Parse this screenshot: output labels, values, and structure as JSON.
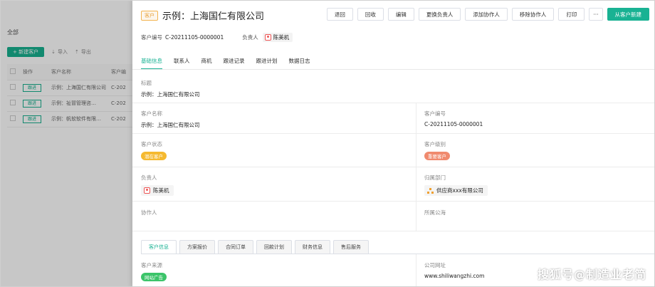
{
  "bg": {
    "crumb": "全部",
    "new_button": "+ 新建客户",
    "import": "导入",
    "export": "导出",
    "columns": [
      "操作",
      "客户名称",
      "客户编"
    ],
    "rows": [
      {
        "action": "跟进",
        "name": "示例：上海国仁有限公司",
        "code": "C-202"
      },
      {
        "action": "跟进",
        "name": "示例：祉冒管理咨…",
        "code": "C-202"
      },
      {
        "action": "跟进",
        "name": "示例：帆软软件有限…",
        "code": "C-202"
      }
    ]
  },
  "header": {
    "tag": "客户",
    "title": "示例：上海国仁有限公司",
    "actions": [
      "退回",
      "回收",
      "编辑",
      "更换负责人",
      "添加协作人",
      "移除协作人",
      "打印"
    ],
    "more": "···",
    "primary": "从客户新建"
  },
  "meta": {
    "code_label": "客户编号",
    "code_value": "C-20211105-0000001",
    "owner_label": "负责人",
    "owner_value": "陈美机"
  },
  "tabs": [
    "基础信息",
    "联系人",
    "商机",
    "跟进记录",
    "跟进计划",
    "数据日志"
  ],
  "fields": {
    "title_label": "标题",
    "title_value": "示例：上海国仁有限公司",
    "name_label": "客户名称",
    "name_value": "示例：上海国仁有限公司",
    "code_label": "客户编号",
    "code_value": "C-20211105-0000001",
    "status_label": "客户状态",
    "status_value": "潜在客户",
    "level_label": "客户级别",
    "level_value": "重要客户",
    "owner_label": "负责人",
    "owner_value": "陈美机",
    "dept_label": "归属部门",
    "dept_value": "供应商xxx有限公司",
    "collab_label": "协作人",
    "pool_label": "所属公海",
    "source_label": "客户来源",
    "source_value": "网站广告",
    "website_label": "公司网址",
    "website_value": "www.shiliwangzhi.com"
  },
  "subtabs": [
    "客户信息",
    "方案报价",
    "合同订单",
    "回款计划",
    "财务信息",
    "售后服务"
  ],
  "colors": {
    "accent": "#19b293",
    "status": "#f5b92f",
    "level": "#f08a6e",
    "source": "#3cc46a",
    "link": "#1e88e5"
  },
  "watermark": "搜狐号@制造业老简"
}
